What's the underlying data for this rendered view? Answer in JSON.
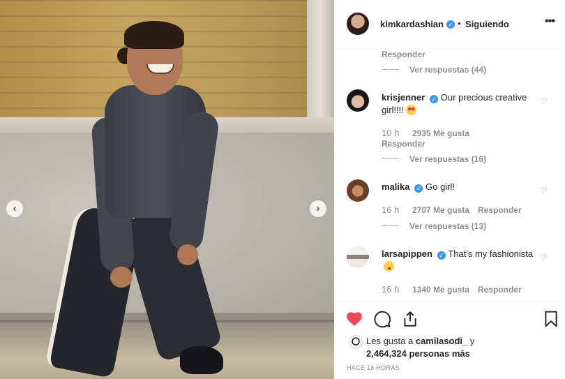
{
  "header": {
    "username": "kimkardashian",
    "separator": "•",
    "follow_status": "Siguiendo",
    "more": "•••"
  },
  "photo": {
    "prev": "‹",
    "next": "›"
  },
  "comments": {
    "top_reply_label": "Responder",
    "top_view_replies": "Ver respuestas (44)",
    "items": [
      {
        "username": "krisjenner",
        "text": "Our precious creative girl!!!!",
        "time": "10 h",
        "likes": "2935 Me gusta",
        "reply": "Responder",
        "view_replies": "Ver respuestas (16)"
      },
      {
        "username": "malika",
        "text": "Go girl!",
        "time": "16 h",
        "likes": "2707 Me gusta",
        "reply": "Responder",
        "view_replies": "Ver respuestas (13)"
      },
      {
        "username": "larsapippen",
        "text": "That's my fashionista",
        "time": "16 h",
        "likes": "1340 Me gusta",
        "reply": "Responder"
      }
    ]
  },
  "likes": {
    "prefix": "Les gusta a",
    "user": "camilasodi_",
    "joiner": "y",
    "count": "2,464,324 personas más"
  },
  "time_ago": "HACE 16 HORAS",
  "colors": {
    "like_red": "#ed4956",
    "verified_blue": "#3897f0",
    "meta_gray": "#8e8e8e"
  }
}
